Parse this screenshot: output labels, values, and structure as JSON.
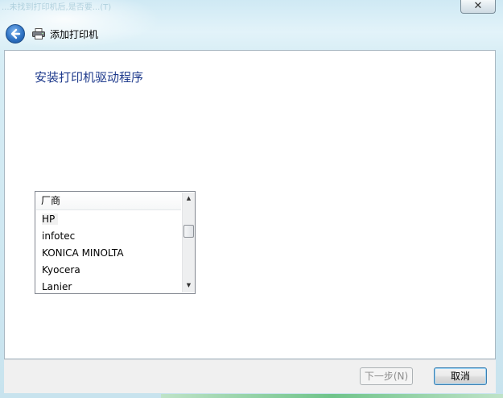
{
  "window": {
    "ghost_title": "...未找到打印机后,是否要...(T)",
    "close_label": "✕"
  },
  "header": {
    "title": "添加打印机",
    "icons": {
      "back": "back-arrow-icon",
      "printer": "printer-icon"
    }
  },
  "main": {
    "heading": "安装打印机驱动程序",
    "manufacturer_list": {
      "header": "厂商",
      "items": [
        "HP",
        "infotec",
        "KONICA MINOLTA",
        "Kyocera",
        "Lanier"
      ],
      "selected_index": 0
    }
  },
  "footer": {
    "next_label": "下一步(N)",
    "cancel_label": "取消"
  },
  "colors": {
    "heading": "#1e3a8c",
    "frame": "#cfe9f4",
    "back_button": "#2f73c4"
  }
}
